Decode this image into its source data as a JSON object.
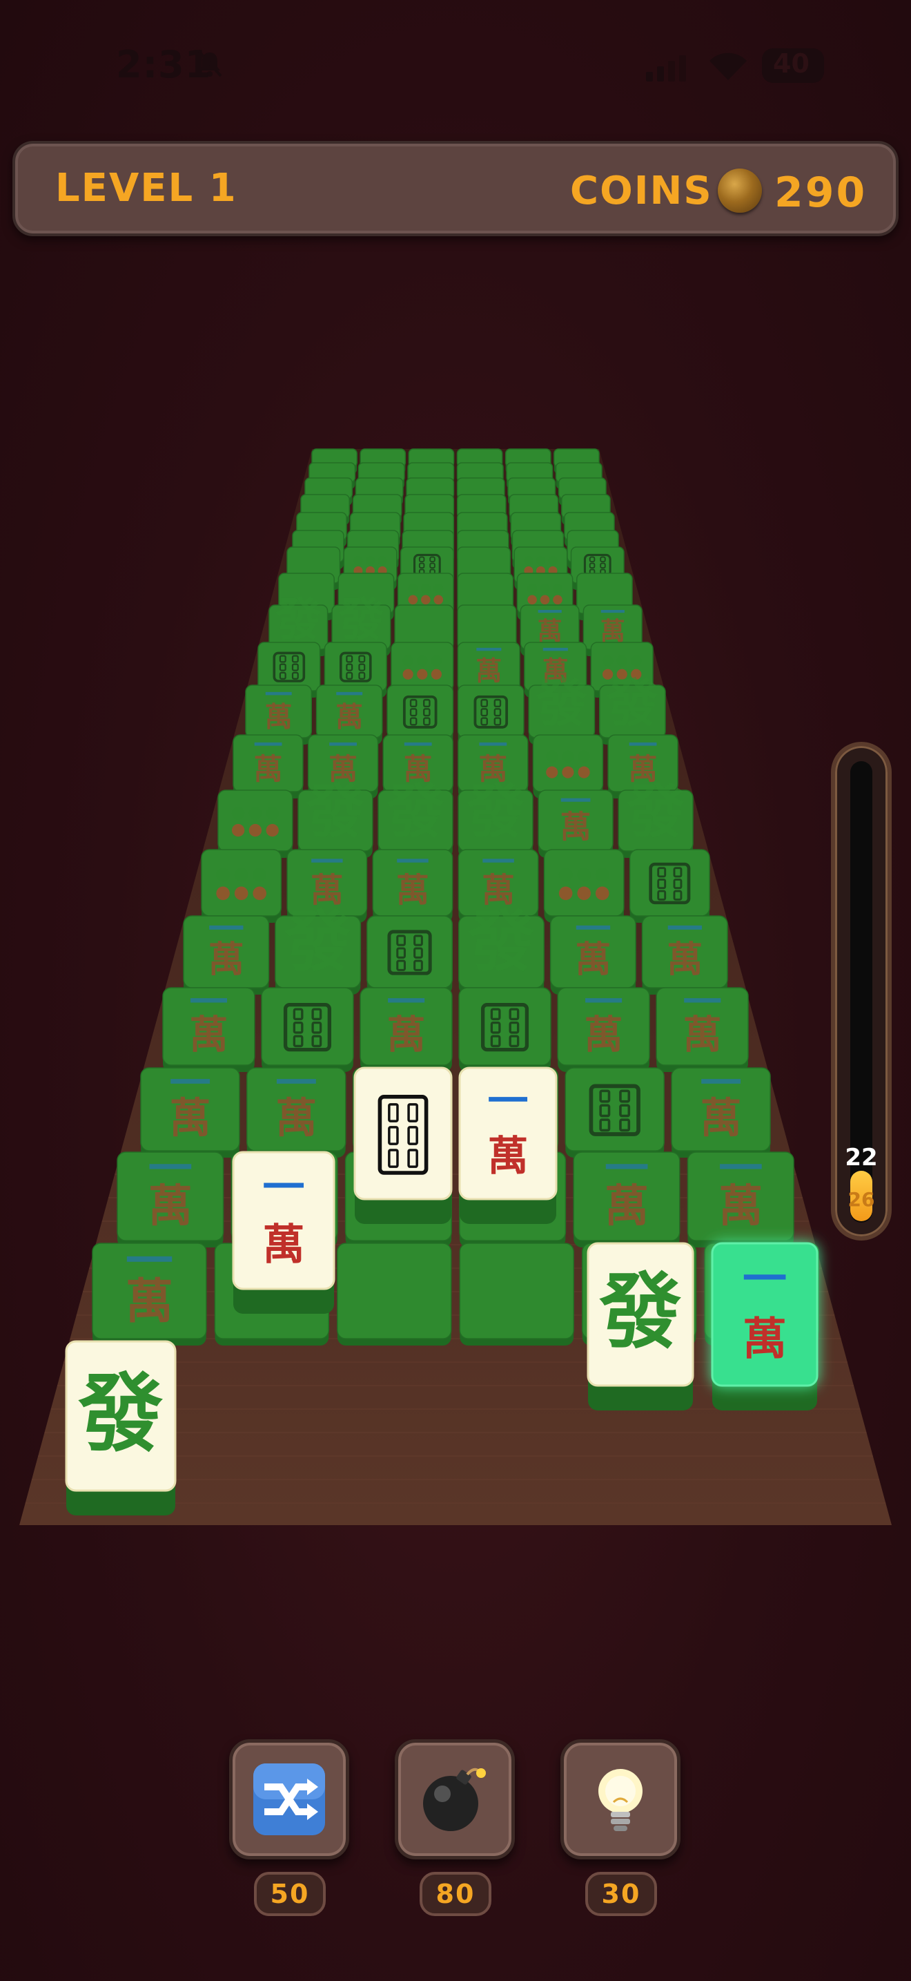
{
  "status_bar": {
    "time": "2:31",
    "battery": "40"
  },
  "header": {
    "level_label": "LEVEL 1",
    "coins_label": "COINS",
    "coins_value": "290"
  },
  "meter": {
    "count": "22",
    "target": "26",
    "fill_fraction": 0.11
  },
  "tiles": {
    "symbols": {
      "wan": {
        "top": "一",
        "bottom": "萬"
      },
      "fa": "發"
    }
  },
  "boosters": [
    {
      "name": "shuffle",
      "icon": "shuffle-icon",
      "price": "50"
    },
    {
      "name": "bomb",
      "icon": "bomb-icon",
      "price": "80"
    },
    {
      "name": "hint",
      "icon": "lightbulb-icon",
      "price": "30"
    }
  ],
  "colors": {
    "accent": "#f5a623",
    "tile_face": "#fbf8e0",
    "tile_back": "#2f8a2f",
    "tile_selected": "#37e08f",
    "wan_red": "#c0302a",
    "fa_green": "#2f8f2f",
    "board_wood": "#4a2a22"
  }
}
